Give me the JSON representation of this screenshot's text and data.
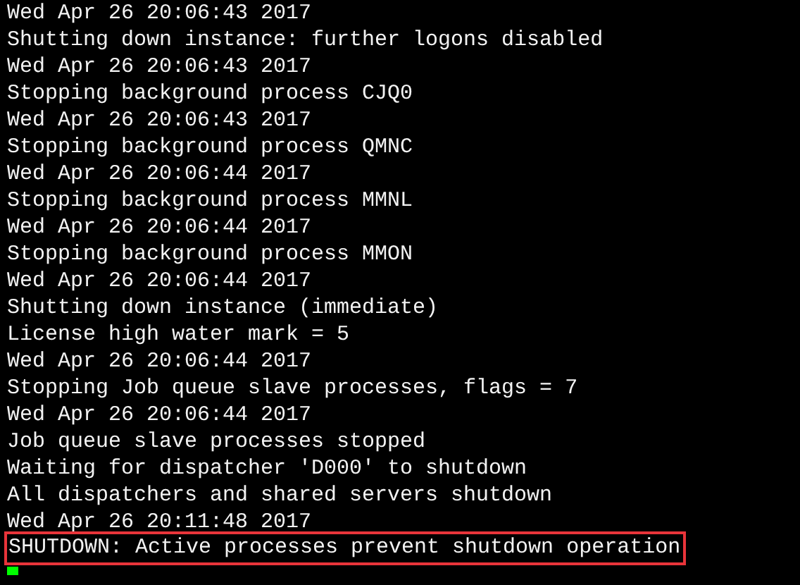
{
  "terminal": {
    "lines": [
      {
        "text": "Wed Apr 26 20:06:43 2017",
        "highlighted": false
      },
      {
        "text": "Shutting down instance: further logons disabled",
        "highlighted": false
      },
      {
        "text": "Wed Apr 26 20:06:43 2017",
        "highlighted": false
      },
      {
        "text": "Stopping background process CJQ0",
        "highlighted": false
      },
      {
        "text": "Wed Apr 26 20:06:43 2017",
        "highlighted": false
      },
      {
        "text": "Stopping background process QMNC",
        "highlighted": false
      },
      {
        "text": "Wed Apr 26 20:06:44 2017",
        "highlighted": false
      },
      {
        "text": "Stopping background process MMNL",
        "highlighted": false
      },
      {
        "text": "Wed Apr 26 20:06:44 2017",
        "highlighted": false
      },
      {
        "text": "Stopping background process MMON",
        "highlighted": false
      },
      {
        "text": "Wed Apr 26 20:06:44 2017",
        "highlighted": false
      },
      {
        "text": "Shutting down instance (immediate)",
        "highlighted": false
      },
      {
        "text": "License high water mark = 5",
        "highlighted": false
      },
      {
        "text": "Wed Apr 26 20:06:44 2017",
        "highlighted": false
      },
      {
        "text": "Stopping Job queue slave processes, flags = 7",
        "highlighted": false
      },
      {
        "text": "Wed Apr 26 20:06:44 2017",
        "highlighted": false
      },
      {
        "text": "Job queue slave processes stopped",
        "highlighted": false
      },
      {
        "text": "Waiting for dispatcher 'D000' to shutdown",
        "highlighted": false
      },
      {
        "text": "All dispatchers and shared servers shutdown",
        "highlighted": false
      },
      {
        "text": "Wed Apr 26 20:11:48 2017",
        "highlighted": false
      },
      {
        "text": "SHUTDOWN: Active processes prevent shutdown operation",
        "highlighted": true
      }
    ],
    "cursor": true
  }
}
